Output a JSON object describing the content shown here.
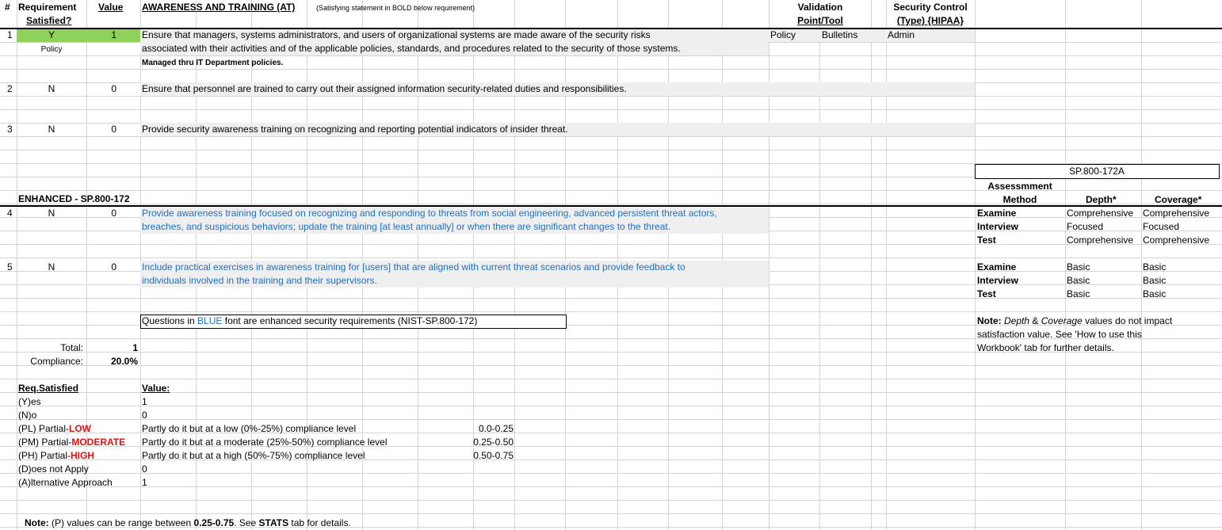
{
  "header": {
    "col_num": "#",
    "col_req": "Requirement",
    "col_req2": "Satisfied?",
    "col_value": "Value",
    "section_title": "AWARENESS AND TRAINING (AT)",
    "section_hint": "(Satisfying statement in BOLD below requirement)",
    "validation": "Validation",
    "validation2": "Point/Tool",
    "security": "Security Control",
    "security2": "(Type) {HIPAA}"
  },
  "rows": [
    {
      "num": "1",
      "sat": "Y",
      "value": "1",
      "sub": "Policy",
      "line1": "Ensure that managers, systems administrators, and users of organizational systems are made aware of the security risks",
      "line2": "associated with their activities and of the applicable policies, standards, and procedures related to the security of those systems.",
      "bold": "Managed thru IT Department policies.",
      "val1": "Policy",
      "val2": "Bulletins",
      "sec": "Admin"
    },
    {
      "num": "2",
      "sat": "N",
      "value": "0",
      "line1": "Ensure that personnel are trained to carry out their assigned information security-related duties and responsibilities."
    },
    {
      "num": "3",
      "sat": "N",
      "value": "0",
      "line1": "Provide security awareness training on recognizing and reporting potential indicators of insider threat."
    }
  ],
  "enhanced_label": "ENHANCED - SP.800-172",
  "enhanced_rows": [
    {
      "num": "4",
      "sat": "N",
      "value": "0",
      "line1": "Provide awareness training focused on recognizing and responding to threats from social engineering, advanced persistent threat actors,",
      "line2": "breaches, and suspicious behaviors; update the training [at least annually] or when there are significant changes to the threat."
    },
    {
      "num": "5",
      "sat": "N",
      "value": "0",
      "line1": "Include practical exercises in awareness training for [users] that are aligned with current threat scenarios and provide feedback to",
      "line2": "individuals involved in the training and their supervisors."
    }
  ],
  "questions_note": {
    "before": "Questions in ",
    "blue": "BLUE",
    "after": " font are enhanced security requirements (NIST-SP.800-172)"
  },
  "totals": {
    "total_label": "Total:",
    "total_value": "1",
    "compliance_label": "Compliance:",
    "compliance_value": "20.0%"
  },
  "legend": {
    "req_header": "Req.Satisfied",
    "value_header": "Value:",
    "items": [
      {
        "a": "(Y)es",
        "v": "1"
      },
      {
        "a": "(N)o",
        "v": "0"
      },
      {
        "a": "(PL) Partial-",
        "red": "LOW",
        "v": "Partly do it but at a low (0%-25%) compliance level",
        "range": "0.0-0.25"
      },
      {
        "a": "(PM) Partial-",
        "red": "MODERATE",
        "v": "Partly do it but at a moderate (25%-50%) compliance level",
        "range": "0.25-0.50"
      },
      {
        "a": "(PH) Partial-",
        "red": "HIGH",
        "v": "Partly do it but at a high (50%-75%) compliance level",
        "range": "0.50-0.75"
      },
      {
        "a": "(D)oes not Apply",
        "v": "0"
      },
      {
        "a": "(A)lternative Approach",
        "v": "1"
      }
    ]
  },
  "bottom_note": {
    "b1": "Note:",
    "t1": " (P) values can be range between ",
    "b2": "0.25-0.75",
    "t2": ".  See ",
    "b3": "STATS",
    "t3": " tab for details."
  },
  "assessment": {
    "box_title": "SP.800-172A",
    "method1": "Assessmment",
    "method2": "Method",
    "depth": "Depth*",
    "coverage": "Coverage*",
    "group1": [
      {
        "m": "Examine",
        "d": "Comprehensive",
        "c": "Comprehensive"
      },
      {
        "m": "Interview",
        "d": "Focused",
        "c": "Focused"
      },
      {
        "m": "Test",
        "d": "Comprehensive",
        "c": "Comprehensive"
      }
    ],
    "group2": [
      {
        "m": "Examine",
        "d": "Basic",
        "c": "Basic"
      },
      {
        "m": "Interview",
        "d": "Basic",
        "c": "Basic"
      },
      {
        "m": "Test",
        "d": "Basic",
        "c": "Basic"
      }
    ],
    "note_bold": "Note:",
    "note_l1a": " ",
    "note_depth": "Depth",
    "note_amp": " & ",
    "note_cov": "Coverage",
    "note_l1b": " values do not impact",
    "note_l2": "satisfaction value.  See 'How to use this",
    "note_l3": "Workbook' tab for further details."
  }
}
